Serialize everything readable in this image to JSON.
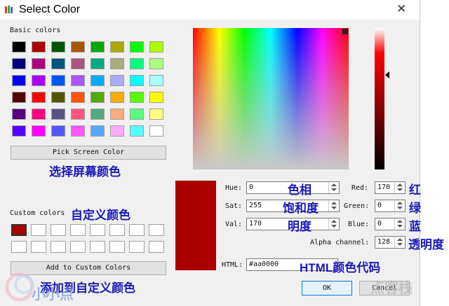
{
  "window": {
    "title": "Select Color",
    "close_icon": "close-icon",
    "app_icon": "color-palette-icon"
  },
  "basic": {
    "label": "Basic colors",
    "swatches": [
      "#000000",
      "#aa0000",
      "#005500",
      "#aa5500",
      "#00aa00",
      "#aaaa00",
      "#00ff00",
      "#aaff00",
      "#00007f",
      "#aa007f",
      "#00557f",
      "#aa557f",
      "#00aa7f",
      "#aaaa7f",
      "#00ff7f",
      "#aaff7f",
      "#0000ff",
      "#aa00ff",
      "#0055ff",
      "#aa55ff",
      "#00aaff",
      "#aaaaff",
      "#00ffff",
      "#aaffff",
      "#550000",
      "#ff0000",
      "#555500",
      "#ff5500",
      "#55aa00",
      "#ffaa00",
      "#55ff00",
      "#ffff00",
      "#55007f",
      "#ff007f",
      "#55557f",
      "#ff557f",
      "#55aa7f",
      "#ffaa7f",
      "#55ff7f",
      "#ffff7f",
      "#5500ff",
      "#ff00ff",
      "#5555ff",
      "#ff55ff",
      "#55aaff",
      "#ffaaff",
      "#55ffff",
      "#ffffff"
    ]
  },
  "pick_screen": {
    "label": "Pick Screen Color",
    "annotation": "选择屏幕颜色"
  },
  "custom": {
    "label": "Custom colors",
    "annotation": "自定义颜色",
    "count": 16
  },
  "add_custom": {
    "label": "Add to Custom Colors",
    "annotation": "添加到自定义颜色"
  },
  "current_color": "#aa0000",
  "fields": {
    "hue": {
      "label": "Hue:",
      "value": "0",
      "annotation": "色相"
    },
    "sat": {
      "label": "Sat:",
      "value": "255",
      "annotation": "饱和度"
    },
    "val": {
      "label": "Val:",
      "value": "170",
      "annotation": "明度"
    },
    "red": {
      "label": "Red:",
      "value": "170",
      "annotation": "红"
    },
    "green": {
      "label": "Green:",
      "value": "0",
      "annotation": "绿"
    },
    "blue": {
      "label": "Blue:",
      "value": "0",
      "annotation": "蓝"
    },
    "alpha": {
      "label": "Alpha channel:",
      "value": "128",
      "annotation": "透明度"
    }
  },
  "html": {
    "label": "HTML:",
    "value": "#aa0000",
    "annotation": "HTML颜色代码"
  },
  "buttons": {
    "ok": "OK",
    "cancel": "Cancel"
  },
  "watermark": {
    "left": "小小点",
    "right": "点客栈"
  }
}
